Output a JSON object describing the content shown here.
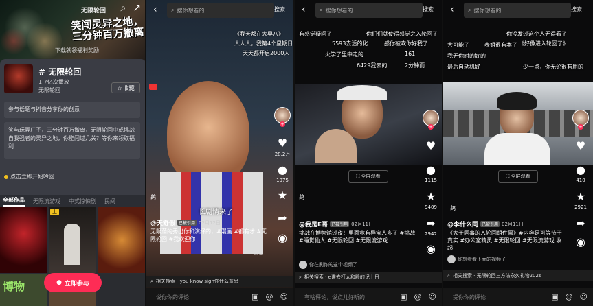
{
  "panel1": {
    "hero_small": "无限轮回",
    "hero_title": "笑闯灵异之地，三分钟百万撤离",
    "hero_sub": "下载就领福利奖励",
    "topic_name": "# 无限轮回",
    "topic_views": "1.7亿次播放",
    "topic_source": "无限轮回",
    "fav_label": "收藏",
    "join_text": "参与话题与抖音分享你的创意",
    "desc_text": "笑与玩弄厂子，三分钟百万撤离，无限轮回中或挑战自我强者的灵异之地，你能闯过几关？等你来领取福利",
    "hint_text": "点击立即开始吟回",
    "tabs": [
      "全部作品",
      "无限流游戏",
      "中式惊悚剧",
      "民间"
    ],
    "join_pill": "立即参与",
    "grid_badge": "上",
    "grid_text": "博物"
  },
  "panel2": {
    "search_placeholder": "搜你想看的",
    "search_btn": "搜索",
    "danmu": [
      "《我天都在大早八》",
      "人人人，我第4个星期日",
      "天天都开启2000人"
    ],
    "subtitle": "长剧情来了",
    "author": "@天舒假",
    "author_badge": "已被引用",
    "date": "02月12日",
    "caption": "无限蒲的秀出你和演绎的，#漫画 #都有才 #无限轮回 #我欢迎你",
    "more": "收起",
    "likes": "28.2万",
    "comments": "1075",
    "shares": "",
    "ai_label": "鸽",
    "related": "相关搜索 · you know sign你什么意思"
  },
  "panel3": {
    "search_placeholder": "搜你想看的",
    "search_btn": "搜索",
    "danmu": [
      "有感觉疑问了",
      "你们们就使得感觉之入轮回了",
      "5593去活的化",
      "感你被欢你好我了",
      "火学了里中走的",
      "161",
      "6429我去的",
      "2分钟而"
    ],
    "fullscreen": "全屏观看",
    "author": "@我是E哥",
    "author_badge": "已被引用",
    "date": "02月11日",
    "caption": "挑战在博物馆过夜！里面竟有异宝人多了 #挑战 #睡觉仙人 #无限轮回 #无限流游戏",
    "likes": "",
    "comments": "1115",
    "shares": "9409",
    "extra": "2942",
    "ai_note": "你在刷你的这个视频了",
    "ai_label": "鸽",
    "related": "相关搜索 · e谁去打太和殿的记上日",
    "comment_placeholder": "有啥评论，说点儿好听的"
  },
  "panel4": {
    "search_placeholder": "搜你想看的",
    "search_btn": "搜索",
    "danmu": [
      "你没发过这个人无得看了",
      "《好像进入轮回了》",
      "表姐很有本了",
      "大可能了",
      "我无你时的好的",
      "少一点，你无论很有用的",
      "最后自动机好"
    ],
    "fullscreen": "全屏观看",
    "author": "@李什么同",
    "author_badge": "已被引用",
    "date": "02月11日",
    "caption": "《大于同事的入轮回组件票》#内容是可等待于真实 #办公室精灵 #无限轮回 #无限流游戏 收起",
    "likes": "",
    "comments": "410",
    "shares": "2921",
    "ai_note": "你想看看下面的视频了",
    "ai_label": "鸽",
    "related": "相关搜索 · 无限轮回三方法永久礼物2026",
    "comment_placeholder": "提你你的评论"
  },
  "comment_placeholder": "说你你的评论",
  "colors": {
    "accent": "#fe2c55",
    "bg": "#000000"
  }
}
